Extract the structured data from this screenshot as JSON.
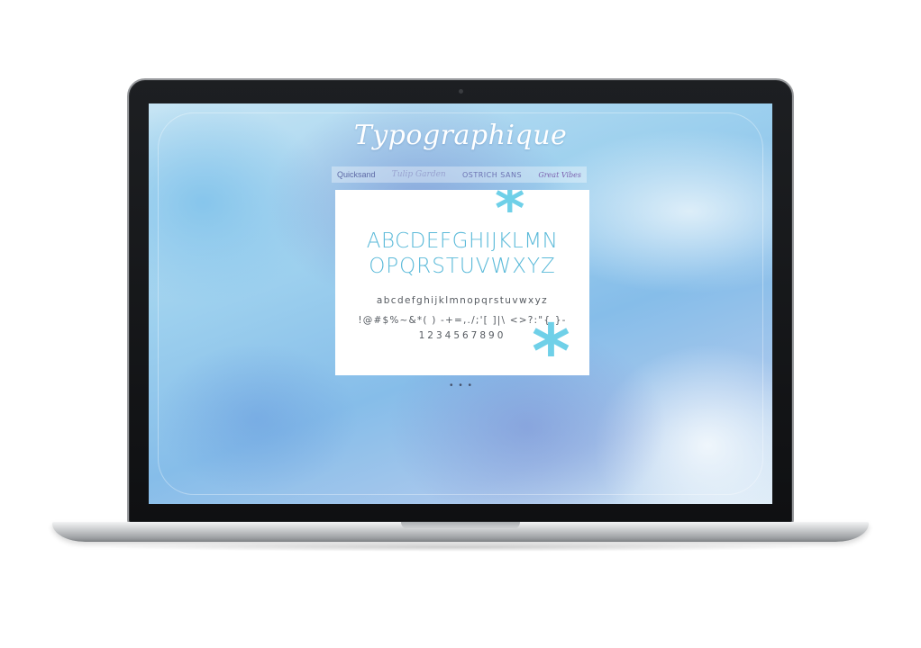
{
  "site": {
    "title": "Typographique"
  },
  "font_nav": {
    "tabs": [
      {
        "label": "Quicksand"
      },
      {
        "label": "Tulip Garden"
      },
      {
        "label": "OSTRICH SANS"
      },
      {
        "label": "Great Vibes"
      }
    ]
  },
  "specimen": {
    "uppercase_line1": "ABCDEFGHIJKLMN",
    "uppercase_line2": "OPQRSTUVWXYZ",
    "lowercase": "abcdefghijklmnopqrstuvwxyz",
    "symbols": "!@#$%~&*( ) -+=,./;'[ ]|\\ <>?:\"{ }-",
    "digits": "1234567890",
    "decoration_glyph": "*"
  },
  "colors": {
    "accent": "#5bbad9",
    "asterisk": "#6fd0e8",
    "nav_text": "#6a72b0",
    "body_text": "#555a60"
  },
  "icons": {
    "asterisk_top": "asterisk-icon",
    "asterisk_bottom": "asterisk-icon",
    "asterisk_outside": "asterisk-icon"
  }
}
